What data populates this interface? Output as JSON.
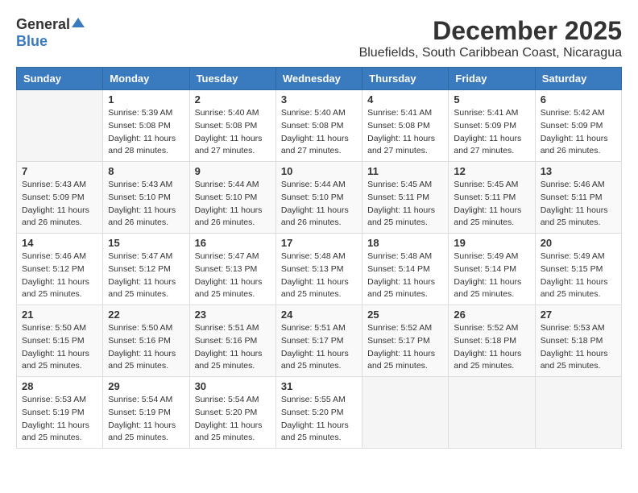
{
  "header": {
    "logo_general": "General",
    "logo_blue": "Blue",
    "title": "December 2025",
    "subtitle": "Bluefields, South Caribbean Coast, Nicaragua"
  },
  "weekdays": [
    "Sunday",
    "Monday",
    "Tuesday",
    "Wednesday",
    "Thursday",
    "Friday",
    "Saturday"
  ],
  "weeks": [
    [
      {
        "day": "",
        "info": ""
      },
      {
        "day": "1",
        "info": "Sunrise: 5:39 AM\nSunset: 5:08 PM\nDaylight: 11 hours\nand 28 minutes."
      },
      {
        "day": "2",
        "info": "Sunrise: 5:40 AM\nSunset: 5:08 PM\nDaylight: 11 hours\nand 27 minutes."
      },
      {
        "day": "3",
        "info": "Sunrise: 5:40 AM\nSunset: 5:08 PM\nDaylight: 11 hours\nand 27 minutes."
      },
      {
        "day": "4",
        "info": "Sunrise: 5:41 AM\nSunset: 5:08 PM\nDaylight: 11 hours\nand 27 minutes."
      },
      {
        "day": "5",
        "info": "Sunrise: 5:41 AM\nSunset: 5:09 PM\nDaylight: 11 hours\nand 27 minutes."
      },
      {
        "day": "6",
        "info": "Sunrise: 5:42 AM\nSunset: 5:09 PM\nDaylight: 11 hours\nand 26 minutes."
      }
    ],
    [
      {
        "day": "7",
        "info": "Sunrise: 5:43 AM\nSunset: 5:09 PM\nDaylight: 11 hours\nand 26 minutes."
      },
      {
        "day": "8",
        "info": "Sunrise: 5:43 AM\nSunset: 5:10 PM\nDaylight: 11 hours\nand 26 minutes."
      },
      {
        "day": "9",
        "info": "Sunrise: 5:44 AM\nSunset: 5:10 PM\nDaylight: 11 hours\nand 26 minutes."
      },
      {
        "day": "10",
        "info": "Sunrise: 5:44 AM\nSunset: 5:10 PM\nDaylight: 11 hours\nand 26 minutes."
      },
      {
        "day": "11",
        "info": "Sunrise: 5:45 AM\nSunset: 5:11 PM\nDaylight: 11 hours\nand 25 minutes."
      },
      {
        "day": "12",
        "info": "Sunrise: 5:45 AM\nSunset: 5:11 PM\nDaylight: 11 hours\nand 25 minutes."
      },
      {
        "day": "13",
        "info": "Sunrise: 5:46 AM\nSunset: 5:11 PM\nDaylight: 11 hours\nand 25 minutes."
      }
    ],
    [
      {
        "day": "14",
        "info": "Sunrise: 5:46 AM\nSunset: 5:12 PM\nDaylight: 11 hours\nand 25 minutes."
      },
      {
        "day": "15",
        "info": "Sunrise: 5:47 AM\nSunset: 5:12 PM\nDaylight: 11 hours\nand 25 minutes."
      },
      {
        "day": "16",
        "info": "Sunrise: 5:47 AM\nSunset: 5:13 PM\nDaylight: 11 hours\nand 25 minutes."
      },
      {
        "day": "17",
        "info": "Sunrise: 5:48 AM\nSunset: 5:13 PM\nDaylight: 11 hours\nand 25 minutes."
      },
      {
        "day": "18",
        "info": "Sunrise: 5:48 AM\nSunset: 5:14 PM\nDaylight: 11 hours\nand 25 minutes."
      },
      {
        "day": "19",
        "info": "Sunrise: 5:49 AM\nSunset: 5:14 PM\nDaylight: 11 hours\nand 25 minutes."
      },
      {
        "day": "20",
        "info": "Sunrise: 5:49 AM\nSunset: 5:15 PM\nDaylight: 11 hours\nand 25 minutes."
      }
    ],
    [
      {
        "day": "21",
        "info": "Sunrise: 5:50 AM\nSunset: 5:15 PM\nDaylight: 11 hours\nand 25 minutes."
      },
      {
        "day": "22",
        "info": "Sunrise: 5:50 AM\nSunset: 5:16 PM\nDaylight: 11 hours\nand 25 minutes."
      },
      {
        "day": "23",
        "info": "Sunrise: 5:51 AM\nSunset: 5:16 PM\nDaylight: 11 hours\nand 25 minutes."
      },
      {
        "day": "24",
        "info": "Sunrise: 5:51 AM\nSunset: 5:17 PM\nDaylight: 11 hours\nand 25 minutes."
      },
      {
        "day": "25",
        "info": "Sunrise: 5:52 AM\nSunset: 5:17 PM\nDaylight: 11 hours\nand 25 minutes."
      },
      {
        "day": "26",
        "info": "Sunrise: 5:52 AM\nSunset: 5:18 PM\nDaylight: 11 hours\nand 25 minutes."
      },
      {
        "day": "27",
        "info": "Sunrise: 5:53 AM\nSunset: 5:18 PM\nDaylight: 11 hours\nand 25 minutes."
      }
    ],
    [
      {
        "day": "28",
        "info": "Sunrise: 5:53 AM\nSunset: 5:19 PM\nDaylight: 11 hours\nand 25 minutes."
      },
      {
        "day": "29",
        "info": "Sunrise: 5:54 AM\nSunset: 5:19 PM\nDaylight: 11 hours\nand 25 minutes."
      },
      {
        "day": "30",
        "info": "Sunrise: 5:54 AM\nSunset: 5:20 PM\nDaylight: 11 hours\nand 25 minutes."
      },
      {
        "day": "31",
        "info": "Sunrise: 5:55 AM\nSunset: 5:20 PM\nDaylight: 11 hours\nand 25 minutes."
      },
      {
        "day": "",
        "info": ""
      },
      {
        "day": "",
        "info": ""
      },
      {
        "day": "",
        "info": ""
      }
    ]
  ]
}
